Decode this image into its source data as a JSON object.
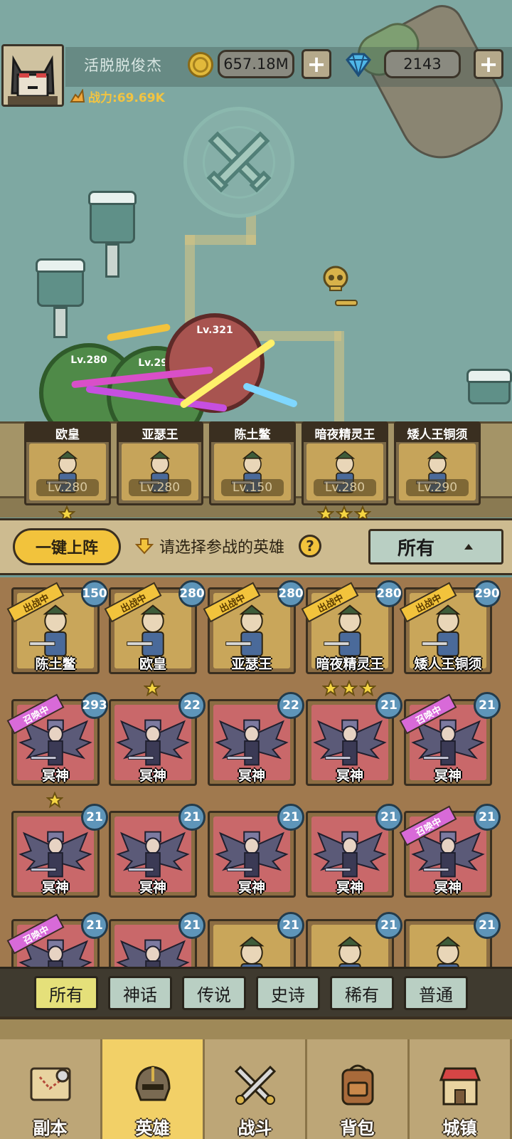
{
  "player": {
    "name": "活脱脱俊杰",
    "power_label": "战力:69.69K"
  },
  "currency": {
    "gold": "657.18M",
    "gems": "2143",
    "add_label": "+"
  },
  "battle": {
    "enemy_level": "Lv.321",
    "ally_levels": [
      "Lv.280",
      "Lv.290"
    ]
  },
  "team": [
    {
      "name": "欧皇",
      "level": "Lv.280",
      "stars": 1
    },
    {
      "name": "亚瑟王",
      "level": "Lv.280",
      "stars": 0
    },
    {
      "name": "陈土鳖",
      "level": "Lv.150",
      "stars": 0
    },
    {
      "name": "暗夜精灵王",
      "level": "Lv.280",
      "stars": 3
    },
    {
      "name": "矮人王铜须",
      "level": "Lv.290",
      "stars": 0
    }
  ],
  "select": {
    "auto_deploy": "一键上阵",
    "hint": "请选择参战的英雄",
    "help": "?",
    "filter": "所有"
  },
  "ribbons": {
    "deploy": "出战中",
    "summon": "召唤中"
  },
  "heroes": [
    {
      "name": "陈土鳖",
      "level": "150",
      "status": "deploy",
      "bg": "gold",
      "stars": 0
    },
    {
      "name": "欧皇",
      "level": "280",
      "status": "deploy",
      "bg": "gold",
      "stars": 1
    },
    {
      "name": "亚瑟王",
      "level": "280",
      "status": "deploy",
      "bg": "gold",
      "stars": 0
    },
    {
      "name": "暗夜精灵王",
      "level": "280",
      "status": "deploy",
      "bg": "gold",
      "stars": 3
    },
    {
      "name": "矮人王铜须",
      "level": "290",
      "status": "deploy",
      "bg": "gold",
      "stars": 0
    },
    {
      "name": "冥神",
      "level": "293",
      "status": "summon",
      "bg": "red",
      "stars": 1
    },
    {
      "name": "冥神",
      "level": "22",
      "status": "",
      "bg": "red",
      "stars": 0
    },
    {
      "name": "冥神",
      "level": "22",
      "status": "",
      "bg": "red",
      "stars": 0
    },
    {
      "name": "冥神",
      "level": "21",
      "status": "",
      "bg": "red",
      "stars": 0
    },
    {
      "name": "冥神",
      "level": "21",
      "status": "summon",
      "bg": "red",
      "stars": 0
    },
    {
      "name": "冥神",
      "level": "21",
      "status": "",
      "bg": "red",
      "stars": 0
    },
    {
      "name": "冥神",
      "level": "21",
      "status": "",
      "bg": "red",
      "stars": 0
    },
    {
      "name": "冥神",
      "level": "21",
      "status": "",
      "bg": "red",
      "stars": 0
    },
    {
      "name": "冥神",
      "level": "21",
      "status": "",
      "bg": "red",
      "stars": 0
    },
    {
      "name": "冥神",
      "level": "21",
      "status": "summon",
      "bg": "red",
      "stars": 0
    },
    {
      "name": "",
      "level": "21",
      "status": "summon",
      "bg": "red",
      "stars": 0
    },
    {
      "name": "",
      "level": "21",
      "status": "",
      "bg": "red",
      "stars": 0
    },
    {
      "name": "",
      "level": "21",
      "status": "",
      "bg": "gold",
      "stars": 0
    },
    {
      "name": "",
      "level": "21",
      "status": "",
      "bg": "gold",
      "stars": 0
    },
    {
      "name": "",
      "level": "21",
      "status": "",
      "bg": "gold",
      "stars": 0
    }
  ],
  "rarity_tabs": [
    "所有",
    "神话",
    "传说",
    "史诗",
    "稀有",
    "普通"
  ],
  "nav": [
    {
      "label": "副本",
      "icon": "map-icon"
    },
    {
      "label": "英雄",
      "icon": "helmet-icon",
      "active": true
    },
    {
      "label": "战斗",
      "icon": "crossed-swords-icon"
    },
    {
      "label": "背包",
      "icon": "backpack-icon"
    },
    {
      "label": "城镇",
      "icon": "shop-icon"
    }
  ],
  "colors": {
    "gold_card": "#c9a65a",
    "red_card": "#c9686a",
    "level_badge": "#5e95b9",
    "accent_yellow": "#f2c33c"
  }
}
